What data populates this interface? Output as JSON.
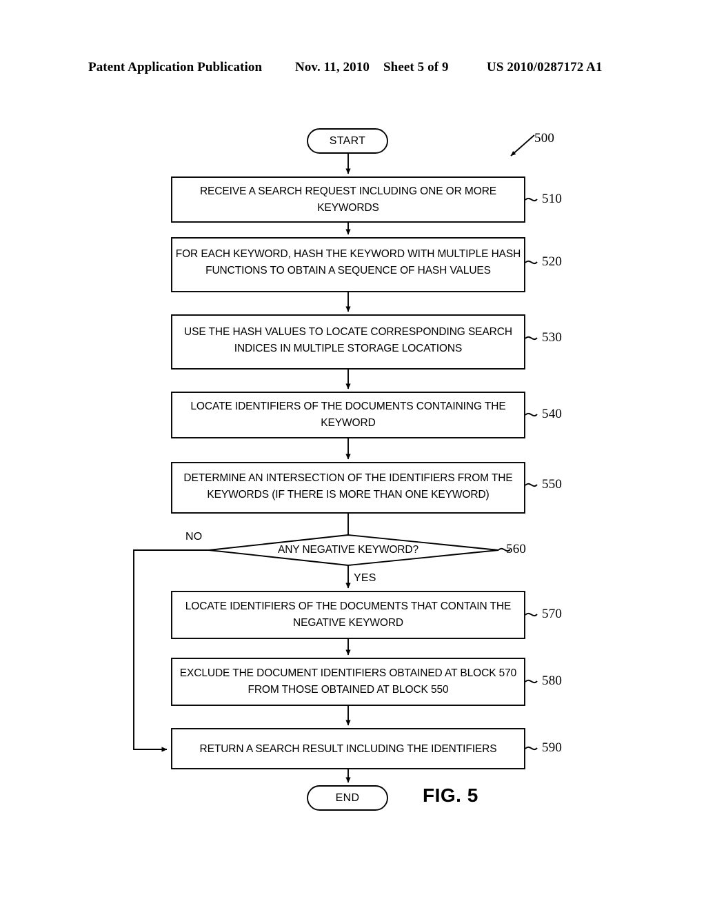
{
  "header": {
    "publication": "Patent Application Publication",
    "date": "Nov. 11, 2010",
    "sheet": "Sheet 5 of 9",
    "doc_number": "US 2010/0287172 A1"
  },
  "figure": {
    "caption": "FIG. 5",
    "diagram_ref": "500",
    "type": "flowchart",
    "nodes": [
      {
        "id": "start",
        "shape": "terminal",
        "label": "START",
        "ref": ""
      },
      {
        "id": "510",
        "shape": "process",
        "label": "RECEIVE A SEARCH REQUEST INCLUDING ONE OR MORE KEYWORDS",
        "ref": "510"
      },
      {
        "id": "520",
        "shape": "process",
        "label": "FOR EACH KEYWORD, HASH THE KEYWORD WITH MULTIPLE HASH FUNCTIONS TO OBTAIN A SEQUENCE OF HASH VALUES",
        "ref": "520"
      },
      {
        "id": "530",
        "shape": "process",
        "label": "USE THE HASH VALUES TO LOCATE CORRESPONDING SEARCH INDICES IN MULTIPLE STORAGE LOCATIONS",
        "ref": "530"
      },
      {
        "id": "540",
        "shape": "process",
        "label": "LOCATE IDENTIFIERS OF THE DOCUMENTS CONTAINING THE KEYWORD",
        "ref": "540"
      },
      {
        "id": "550",
        "shape": "process",
        "label": "DETERMINE AN INTERSECTION OF THE IDENTIFIERS FROM THE KEYWORDS (IF THERE IS MORE THAN ONE KEYWORD)",
        "ref": "550"
      },
      {
        "id": "560",
        "shape": "decision",
        "label": "ANY NEGATIVE KEYWORD?",
        "ref": "560"
      },
      {
        "id": "570",
        "shape": "process",
        "label": "LOCATE IDENTIFIERS OF THE DOCUMENTS THAT CONTAIN THE NEGATIVE KEYWORD",
        "ref": "570"
      },
      {
        "id": "580",
        "shape": "process",
        "label": "EXCLUDE THE DOCUMENT IDENTIFIERS OBTAINED AT BLOCK 570 FROM THOSE OBTAINED AT BLOCK 550",
        "ref": "580"
      },
      {
        "id": "590",
        "shape": "process",
        "label": "RETURN A SEARCH RESULT INCLUDING THE IDENTIFIERS",
        "ref": "590"
      },
      {
        "id": "end",
        "shape": "terminal",
        "label": "END",
        "ref": ""
      }
    ],
    "branch_labels": {
      "no": "NO",
      "yes": "YES"
    },
    "edges": [
      {
        "from": "start",
        "to": "510",
        "label": ""
      },
      {
        "from": "510",
        "to": "520",
        "label": ""
      },
      {
        "from": "520",
        "to": "530",
        "label": ""
      },
      {
        "from": "530",
        "to": "540",
        "label": ""
      },
      {
        "from": "540",
        "to": "550",
        "label": ""
      },
      {
        "from": "550",
        "to": "560",
        "label": ""
      },
      {
        "from": "560",
        "to": "570",
        "label": "YES"
      },
      {
        "from": "560",
        "to": "590",
        "label": "NO"
      },
      {
        "from": "570",
        "to": "580",
        "label": ""
      },
      {
        "from": "580",
        "to": "590",
        "label": ""
      },
      {
        "from": "590",
        "to": "end",
        "label": ""
      }
    ]
  },
  "colors": {
    "ink": "#000000",
    "paper": "#ffffff"
  }
}
